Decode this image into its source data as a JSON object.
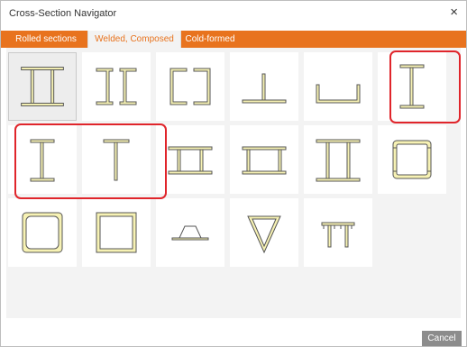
{
  "window": {
    "title": "Cross-Section Navigator",
    "close_glyph": "×"
  },
  "tabs": [
    {
      "label": "Rolled sections"
    },
    {
      "label": "Welded, Composed"
    },
    {
      "label": "Cold-formed"
    }
  ],
  "active_tab": "Welded, Composed",
  "sections": [
    {
      "icon": "double-i-section-icon"
    },
    {
      "icon": "double-channel-back-to-back-icon"
    },
    {
      "icon": "double-channel-box-icon"
    },
    {
      "icon": "t-on-plate-icon"
    },
    {
      "icon": "open-channel-icon"
    },
    {
      "icon": "i-section-icon"
    },
    {
      "icon": "welded-i-section-icon"
    },
    {
      "icon": "welded-t-section-icon"
    },
    {
      "icon": "i-with-wide-flanges-icon"
    },
    {
      "icon": "box-flanged-icon"
    },
    {
      "icon": "double-i-flanged-icon"
    },
    {
      "icon": "box-channel-icon"
    },
    {
      "icon": "rounded-box-icon"
    },
    {
      "icon": "square-box-icon"
    },
    {
      "icon": "trapezoid-icon"
    },
    {
      "icon": "triangle-icon"
    },
    {
      "icon": "multi-t-section-icon"
    }
  ],
  "footer": {
    "cancel_label": "Cancel"
  },
  "colors": {
    "accent": "#e8731e",
    "highlight": "#e0252b",
    "section_fill": "#f7f2b4"
  }
}
